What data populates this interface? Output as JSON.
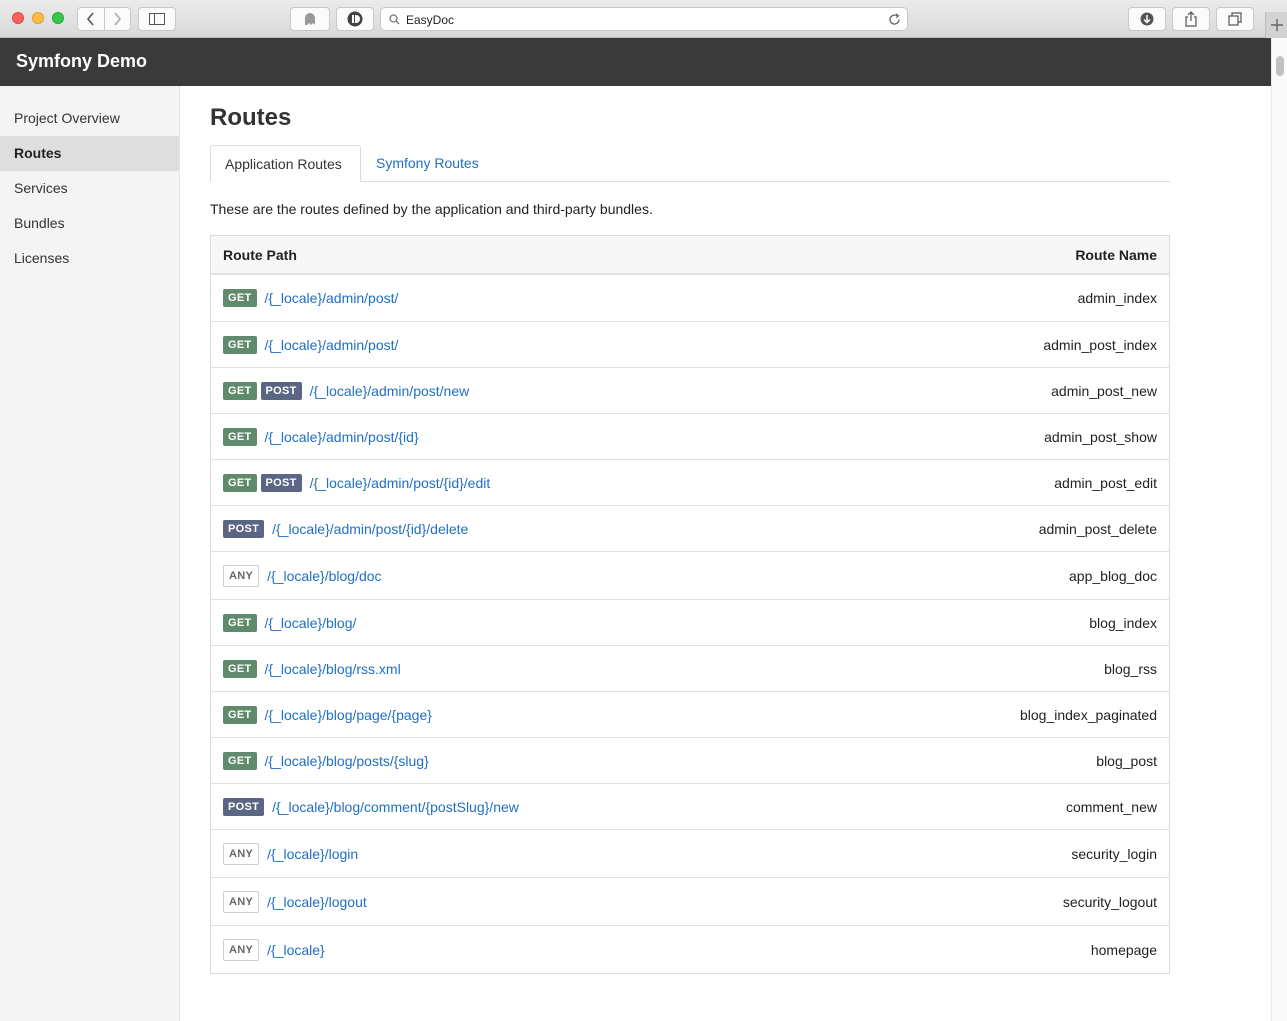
{
  "browser": {
    "url_text": "EasyDoc"
  },
  "app": {
    "title": "Symfony Demo"
  },
  "sidebar": {
    "items": [
      {
        "label": "Project Overview",
        "active": false
      },
      {
        "label": "Routes",
        "active": true
      },
      {
        "label": "Services",
        "active": false
      },
      {
        "label": "Bundles",
        "active": false
      },
      {
        "label": "Licenses",
        "active": false
      }
    ]
  },
  "main": {
    "title": "Routes",
    "tabs": [
      {
        "label": "Application Routes",
        "active": true
      },
      {
        "label": "Symfony Routes",
        "active": false
      }
    ],
    "intro": "These are the routes defined by the application and third-party bundles.",
    "table": {
      "headers": {
        "path": "Route Path",
        "name": "Route Name"
      },
      "rows": [
        {
          "methods": [
            "GET"
          ],
          "path": "/{_locale}/admin/post/",
          "name": "admin_index"
        },
        {
          "methods": [
            "GET"
          ],
          "path": "/{_locale}/admin/post/",
          "name": "admin_post_index"
        },
        {
          "methods": [
            "GET",
            "POST"
          ],
          "path": "/{_locale}/admin/post/new",
          "name": "admin_post_new"
        },
        {
          "methods": [
            "GET"
          ],
          "path": "/{_locale}/admin/post/{id}",
          "name": "admin_post_show"
        },
        {
          "methods": [
            "GET",
            "POST"
          ],
          "path": "/{_locale}/admin/post/{id}/edit",
          "name": "admin_post_edit"
        },
        {
          "methods": [
            "POST"
          ],
          "path": "/{_locale}/admin/post/{id}/delete",
          "name": "admin_post_delete"
        },
        {
          "methods": [
            "ANY"
          ],
          "path": "/{_locale}/blog/doc",
          "name": "app_blog_doc"
        },
        {
          "methods": [
            "GET"
          ],
          "path": "/{_locale}/blog/",
          "name": "blog_index"
        },
        {
          "methods": [
            "GET"
          ],
          "path": "/{_locale}/blog/rss.xml",
          "name": "blog_rss"
        },
        {
          "methods": [
            "GET"
          ],
          "path": "/{_locale}/blog/page/{page}",
          "name": "blog_index_paginated"
        },
        {
          "methods": [
            "GET"
          ],
          "path": "/{_locale}/blog/posts/{slug}",
          "name": "blog_post"
        },
        {
          "methods": [
            "POST"
          ],
          "path": "/{_locale}/blog/comment/{postSlug}/new",
          "name": "comment_new"
        },
        {
          "methods": [
            "ANY"
          ],
          "path": "/{_locale}/login",
          "name": "security_login"
        },
        {
          "methods": [
            "ANY"
          ],
          "path": "/{_locale}/logout",
          "name": "security_logout"
        },
        {
          "methods": [
            "ANY"
          ],
          "path": "/{_locale}",
          "name": "homepage"
        }
      ]
    }
  },
  "colors": {
    "get_badge": "#5f8a6b",
    "post_badge": "#5a6684",
    "link": "#1f6fc5",
    "header_bg": "#3a3a3a"
  },
  "icons": [
    "back-icon",
    "forward-icon",
    "sidebar-toggle-icon",
    "ghostery-icon",
    "extension-icon",
    "search-icon",
    "reload-icon",
    "download-icon",
    "share-icon",
    "tabs-icon",
    "new-tab-icon"
  ]
}
